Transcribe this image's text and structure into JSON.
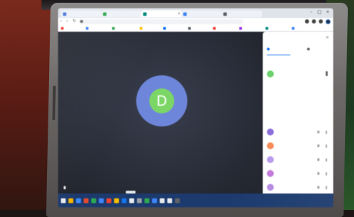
{
  "scene": {
    "description_type": "photo of laptop screen showing a video call"
  },
  "call": {
    "avatar_letter": "D"
  },
  "colors": {
    "avatar_ring": "#6f86d6",
    "avatar_fill": "#7fd56a",
    "taskbar": "#1d3a6b",
    "panel_bg": "#ffffff"
  },
  "participants_panel": {
    "host_avatar_color": "#6fcf6f",
    "avatar_colors": [
      "#8a6fd6",
      "#f28b5a",
      "#b79be8",
      "#c07ad8",
      "#b58be0",
      "#5aa6e8"
    ]
  },
  "icons": {
    "browser_tab_favicon": "favicon-icon",
    "mic": "microphone-icon",
    "more": "more-vert-icon",
    "close": "close-icon",
    "people": "people-icon",
    "lock": "lock-icon"
  }
}
